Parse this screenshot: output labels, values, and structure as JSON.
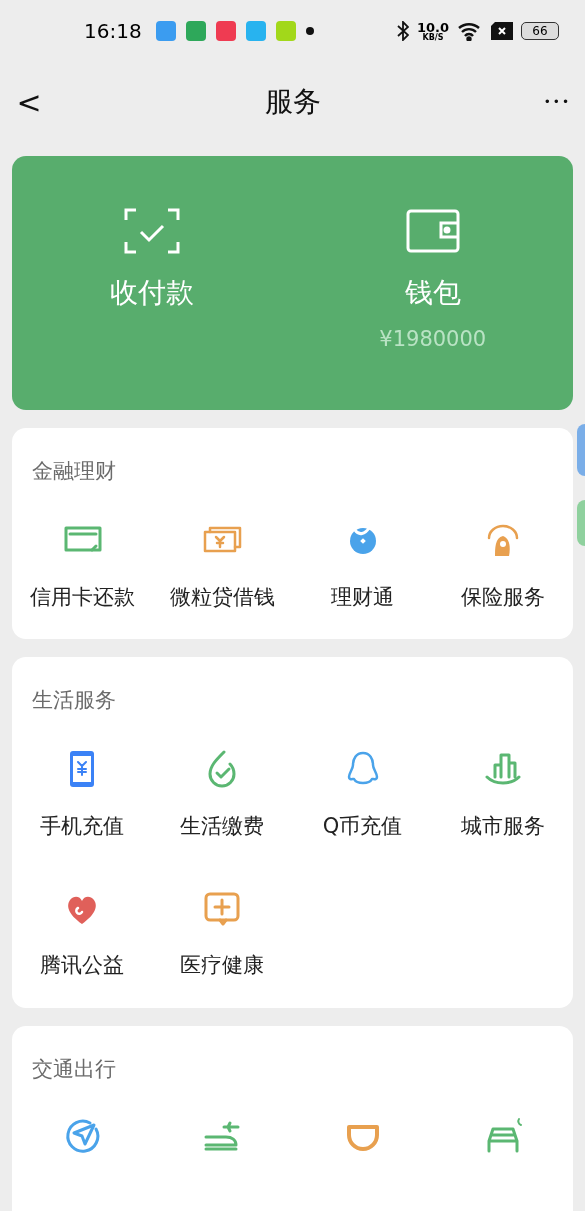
{
  "status_bar": {
    "time": "16:18",
    "speed": "10.0",
    "speed_unit": "KB/S",
    "battery": "66"
  },
  "header": {
    "back": "<",
    "title": "服务",
    "more": "•••"
  },
  "top_card": [
    {
      "label": "收付款"
    },
    {
      "label": "钱包",
      "amount": "¥1980000"
    }
  ],
  "sections": [
    {
      "title": "金融理财",
      "items": [
        {
          "label": "信用卡还款"
        },
        {
          "label": "微粒贷借钱"
        },
        {
          "label": "理财通"
        },
        {
          "label": "保险服务"
        }
      ]
    },
    {
      "title": "生活服务",
      "items": [
        {
          "label": "手机充值"
        },
        {
          "label": "生活缴费"
        },
        {
          "label": "Q币充值"
        },
        {
          "label": "城市服务"
        },
        {
          "label": "腾讯公益"
        },
        {
          "label": "医疗健康"
        }
      ]
    },
    {
      "title": "交通出行",
      "items": [
        {
          "kind": "icon_only"
        },
        {
          "kind": "icon_only"
        },
        {
          "kind": "icon_only"
        },
        {
          "kind": "icon_only"
        }
      ]
    }
  ]
}
